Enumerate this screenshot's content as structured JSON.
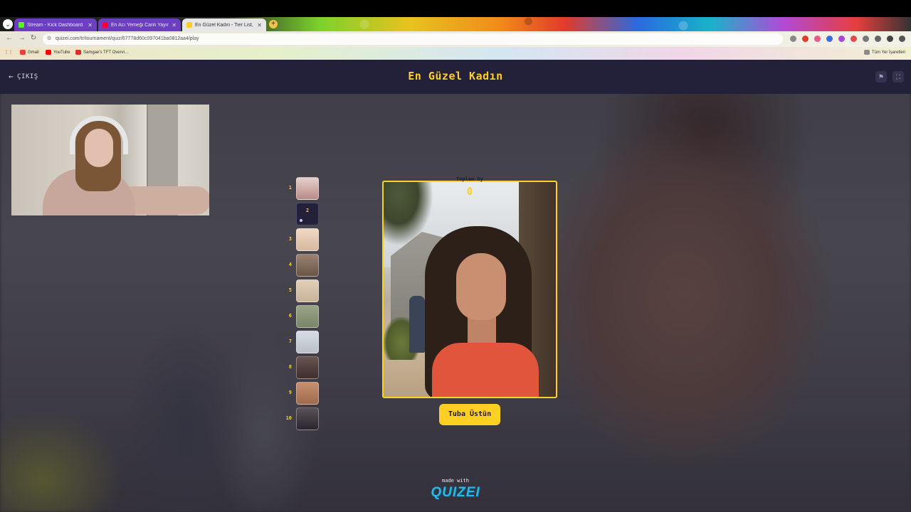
{
  "browser": {
    "tabs": [
      {
        "title": "Stream - Kick Dashboard",
        "favicon_color": "#53fc18"
      },
      {
        "title": "En Acı Yemeği Canlı Yayın Olarak…",
        "favicon_color": "#ff0033"
      },
      {
        "title": "En Güzel Kadın - Tier List, Kör…",
        "favicon_color": "#ffcf24"
      }
    ],
    "url": "quizei.com/tr/tournament/quiz/67778d60c097041ba0812aa4/play",
    "bookmarks": [
      {
        "label": "Gmail",
        "color": "#ea4335"
      },
      {
        "label": "YouTube",
        "color": "#ff0000"
      },
      {
        "label": "Samgae's TFT Overvi…",
        "color": "#d9302c"
      }
    ],
    "bookmarks_right": "Tüm Yer İşaretleri"
  },
  "header": {
    "back_label": "ÇIKIŞ",
    "title": "En Güzel Kadın"
  },
  "progress": {
    "items": [
      {
        "num": "1",
        "state": "done",
        "color": "#b98a86"
      },
      {
        "num": "2",
        "state": "current",
        "color": "#23213a"
      },
      {
        "num": "3",
        "state": "pending",
        "color": "#d8b89e"
      },
      {
        "num": "4",
        "state": "pending",
        "color": "#6b5446"
      },
      {
        "num": "5",
        "state": "pending",
        "color": "#c9b39a"
      },
      {
        "num": "6",
        "state": "pending",
        "color": "#7a8468"
      },
      {
        "num": "7",
        "state": "pending",
        "color": "#b9c0c8"
      },
      {
        "num": "8",
        "state": "pending",
        "color": "#3e2e2c"
      },
      {
        "num": "9",
        "state": "pending",
        "color": "#a06a4e"
      },
      {
        "num": "10",
        "state": "pending",
        "color": "#2a2530"
      }
    ]
  },
  "card": {
    "total_label": "Toplam Oy",
    "total_value": "0",
    "choice_label": "Tuba Üstün"
  },
  "footer": {
    "made_with": "made with",
    "brand": "QUIZEI"
  },
  "colors": {
    "accent": "#ffcf24",
    "header_bg": "#23213a"
  }
}
